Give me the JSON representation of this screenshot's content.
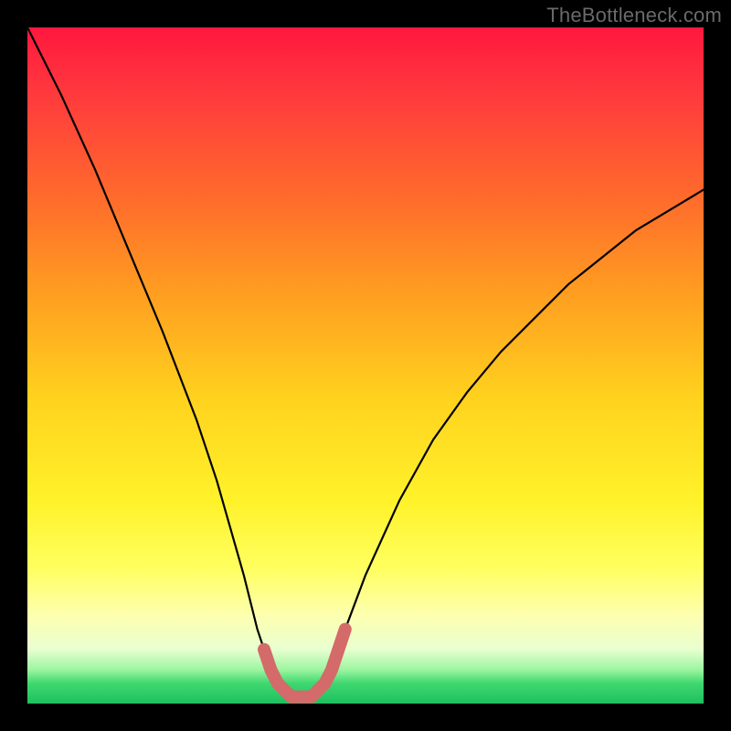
{
  "watermark": "TheBottleneck.com",
  "chart_data": {
    "type": "line",
    "title": "",
    "xlabel": "",
    "ylabel": "",
    "xlim": [
      0,
      100
    ],
    "ylim": [
      0,
      100
    ],
    "series": [
      {
        "name": "bottleneck-curve",
        "x": [
          0,
          5,
          10,
          15,
          20,
          25,
          28,
          30,
          32,
          34,
          35,
          36,
          37,
          38,
          39,
          40,
          41,
          42,
          43,
          44,
          45,
          46,
          47,
          50,
          55,
          60,
          65,
          70,
          75,
          80,
          85,
          90,
          95,
          100
        ],
        "values": [
          100,
          90,
          79,
          67,
          55,
          42,
          33,
          26,
          19,
          11,
          8,
          5,
          3,
          2,
          1,
          1,
          1,
          1,
          2,
          3,
          5,
          8,
          11,
          19,
          30,
          39,
          46,
          52,
          57,
          62,
          66,
          70,
          73,
          76
        ]
      },
      {
        "name": "highlight-band",
        "x": [
          35,
          36,
          37,
          38,
          39,
          40,
          41,
          42,
          43,
          44,
          45,
          46,
          47
        ],
        "values": [
          8,
          5,
          3,
          2,
          1,
          1,
          1,
          1,
          2,
          3,
          5,
          8,
          11
        ]
      }
    ],
    "colors": {
      "curve": "#000000",
      "highlight": "#d46a6a",
      "gradient_top": "#ff173f",
      "gradient_bottom": "#1fbf60"
    }
  }
}
